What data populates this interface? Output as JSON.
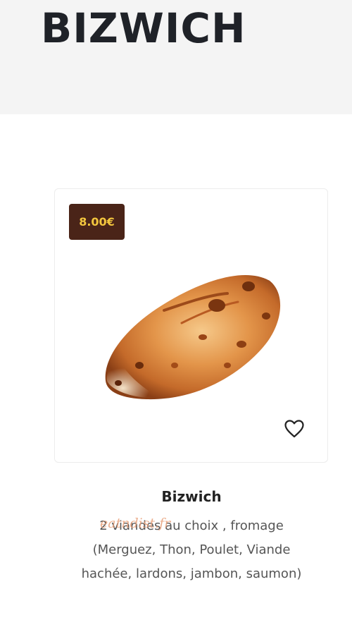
{
  "header": {
    "title": "BIZWICH"
  },
  "product": {
    "price": "8.00€",
    "name": "Bizwich",
    "description": "2 viandes au choix , fromage (Merguez, Thon, Poulet, Viande hachée, lardons, jambon, saumon)",
    "image_icon": "bread-pastry-image",
    "favorite_icon": "heart-outline-icon"
  },
  "watermark": {
    "text": "eatndist.fr"
  },
  "colors": {
    "header_bg": "#f4f4f4",
    "badge_bg": "#4a2418",
    "badge_text": "#f3c63e",
    "title": "#1f2228"
  }
}
